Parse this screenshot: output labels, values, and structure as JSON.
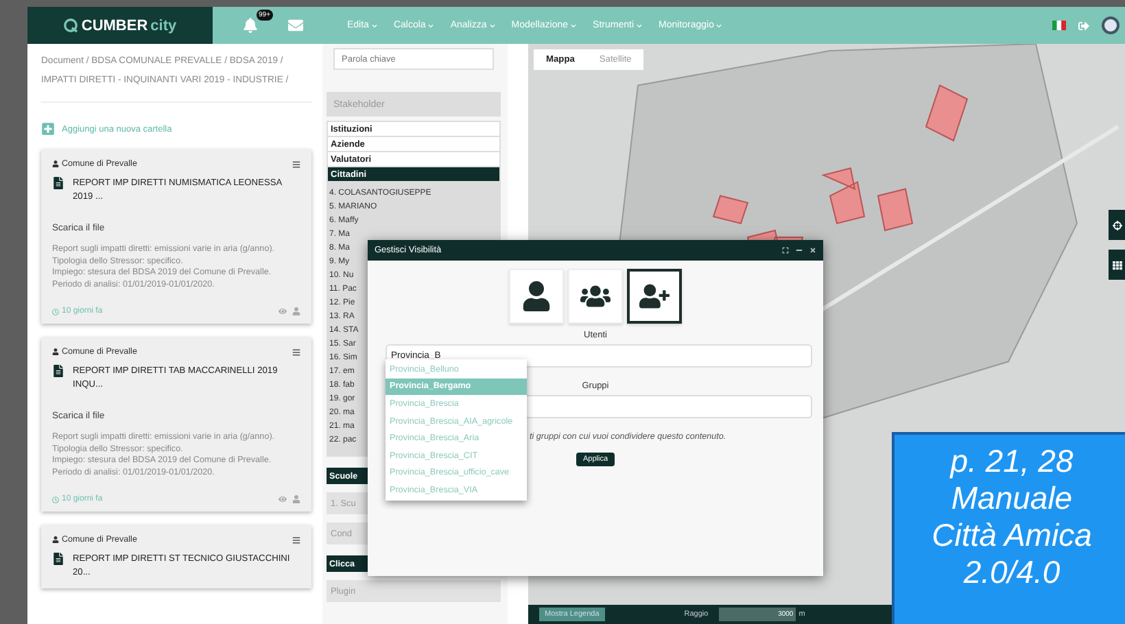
{
  "nav": {
    "logo": {
      "text": "CUMBER",
      "accent": "city"
    },
    "badge": "99+",
    "menus": [
      "Edita",
      "Calcola",
      "Analizza",
      "Modellazione",
      "Strumenti",
      "Monitoraggio"
    ]
  },
  "breadcrumb": "Document / BDSA COMUNALE PREVALLE / BDSA 2019 / IMPATTI DIRETTI - INQUINANTI VARI 2019 - INDUSTRIE /",
  "add_folder": "Aggiungi una nuova cartella",
  "documents": [
    {
      "author": "Comune di Prevalle",
      "title": "REPORT IMP DIRETTI NUMISMATICA LEONESSA 2019 ...",
      "download": "Scarica il file",
      "description": [
        "Report sugli impatti diretti: emissioni varie in aria (g/anno).",
        "Tipologia dello Stressor: specifico.",
        "Impiego: stesura del BDSA 2019 del Comune di Prevalle.",
        "Periodo di analisi: 01/01/2019-01/01/2020."
      ],
      "time": "10 giorni fa"
    },
    {
      "author": "Comune di Prevalle",
      "title": "REPORT IMP DIRETTI TAB MACCARINELLI 2019 INQU...",
      "download": "Scarica il file",
      "description": [
        "Report sugli impatti diretti: emissioni varie in aria (g/anno).",
        "Tipologia dello Stressor: specifico.",
        "Impiego: stesura del BDSA 2019 del Comune di Prevalle.",
        "Periodo di analisi: 01/01/2019-01/01/2020."
      ],
      "time": "10 giorni fa"
    },
    {
      "author": "Comune di Prevalle",
      "title": "REPORT IMP DIRETTI ST TECNICO GIUSTACCHINI 20..."
    }
  ],
  "search": {
    "placeholder": "Parola chiave"
  },
  "stakeholder": {
    "title": "Stakeholder",
    "categories": [
      {
        "label": "Istituzioni",
        "selected": false
      },
      {
        "label": "Aziende",
        "selected": false
      },
      {
        "label": "Valutatori",
        "selected": false
      },
      {
        "label": "Cittadini",
        "selected": true
      }
    ],
    "items": [
      "4. COLASANTOGIUSEPPE",
      "5. MARIANO",
      "6. Maffy",
      "7. Ma",
      "8. Ma",
      "9. My",
      "10. Nu",
      "11. Pac",
      "12. Pie",
      "13. RA",
      "14. STA",
      "15. Sar",
      "16. Sim",
      "17. em",
      "18. fab",
      "19. gor",
      "20. ma",
      "21. ma",
      "22. pac"
    ]
  },
  "sections": [
    {
      "kind": "header",
      "label": "Scuole"
    },
    {
      "kind": "box",
      "label": "1. Scu"
    },
    {
      "kind": "box",
      "label": "Cond"
    },
    {
      "kind": "header",
      "label": "Clicca"
    },
    {
      "kind": "box",
      "label": "Plugin"
    }
  ],
  "map": {
    "tabs": [
      {
        "label": "Mappa",
        "selected": true
      },
      {
        "label": "Satellite",
        "selected": false
      }
    ],
    "legend_button": "Mostra Legenda",
    "radius_label": "Raggio",
    "radius_value": "3000",
    "radius_unit": "m"
  },
  "dialog": {
    "title": "Gestisci Visibilità",
    "modes": [
      {
        "kind": "user",
        "selected": false
      },
      {
        "kind": "users",
        "selected": false
      },
      {
        "kind": "user-plus",
        "selected": true
      }
    ],
    "users_label": "Utenti",
    "users_value": "Provincia_B",
    "suggestions": [
      {
        "label": "Provincia_Belluno",
        "selected": false
      },
      {
        "label": "Provincia_Bergamo",
        "selected": true
      },
      {
        "label": "Provincia_Brescia",
        "selected": false
      },
      {
        "label": "Provincia_Brescia_AIA_agricole",
        "selected": false
      },
      {
        "label": "Provincia_Brescia_Aria",
        "selected": false
      },
      {
        "label": "Provincia_Brescia_CIT",
        "selected": false
      },
      {
        "label": "Provincia_Brescia_ufficio_cave",
        "selected": false
      },
      {
        "label": "Provincia_Brescia_VIA",
        "selected": false
      }
    ],
    "groups_label": "Gruppi",
    "hint": "ti gruppi con cui vuoi condividere questo contenuto.",
    "apply": "Applica"
  },
  "annotation": [
    "p. 21, 28",
    "Manuale",
    "Città Amica",
    "2.0/4.0"
  ]
}
